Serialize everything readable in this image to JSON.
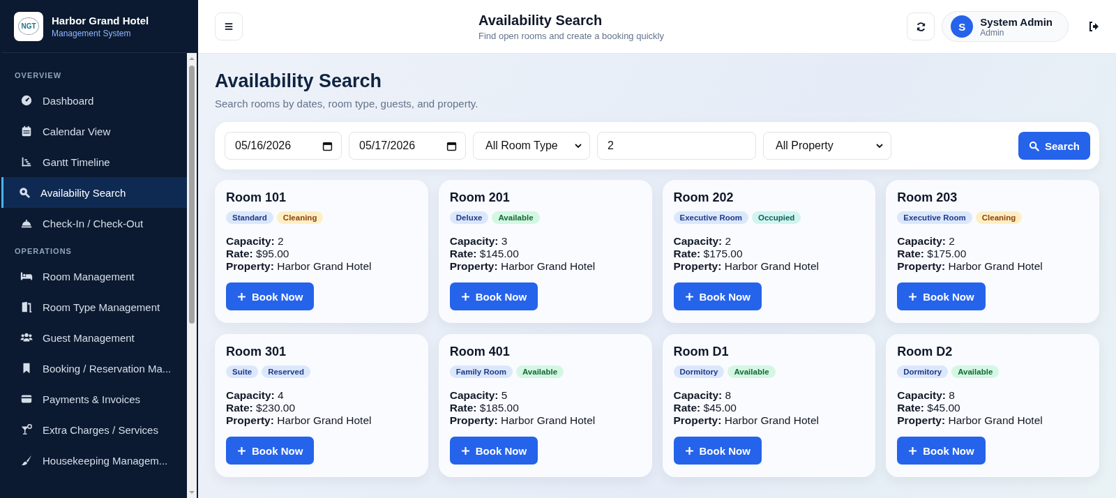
{
  "brand": {
    "logo": "NGT",
    "name": "Harbor Grand Hotel",
    "subtitle": "Management System"
  },
  "sidebar": {
    "sections": [
      {
        "title": "OVERVIEW",
        "items": [
          {
            "label": "Dashboard",
            "kind": "gauge",
            "selected": false
          },
          {
            "label": "Calendar View",
            "kind": "calendar",
            "selected": false
          },
          {
            "label": "Gantt Timeline",
            "kind": "gantt",
            "selected": false
          },
          {
            "label": "Availability Search",
            "kind": "search",
            "selected": true
          },
          {
            "label": "Check-In / Check-Out",
            "kind": "bell",
            "selected": false
          }
        ]
      },
      {
        "title": "OPERATIONS",
        "items": [
          {
            "label": "Room Management",
            "kind": "bed",
            "selected": false
          },
          {
            "label": "Room Type Management",
            "kind": "door",
            "selected": false
          },
          {
            "label": "Guest Management",
            "kind": "users",
            "selected": false
          },
          {
            "label": "Booking / Reservation Ma...",
            "kind": "bookmark",
            "selected": false
          },
          {
            "label": "Payments & Invoices",
            "kind": "card",
            "selected": false
          },
          {
            "label": "Extra Charges / Services",
            "kind": "glass",
            "selected": false
          },
          {
            "label": "Housekeeping Managem...",
            "kind": "brush",
            "selected": false
          }
        ]
      }
    ]
  },
  "header": {
    "title": "Availability Search",
    "subtitle": "Find open rooms and create a booking quickly",
    "user": {
      "initial": "S",
      "name": "System Admin",
      "role": "Admin"
    }
  },
  "page": {
    "title": "Availability Search",
    "subtitle": "Search rooms by dates, room type, guests, and property."
  },
  "filters": {
    "check_in": "05/16/2026",
    "check_out": "05/17/2026",
    "room_type": "All Room Type",
    "guests": "2",
    "property": "All Property",
    "search_button": "Search"
  },
  "rooms": [
    {
      "name": "Room 101",
      "type": "Standard",
      "status": {
        "label": "Cleaning",
        "kind": "cleaning"
      },
      "capacity_label": "Capacity:",
      "capacity": "2",
      "rate_label": "Rate:",
      "rate": "$95.00",
      "property_label": "Property:",
      "property": "Harbor Grand Hotel",
      "button": "Book Now"
    },
    {
      "name": "Room 201",
      "type": "Deluxe",
      "status": {
        "label": "Available",
        "kind": "available"
      },
      "capacity_label": "Capacity:",
      "capacity": "3",
      "rate_label": "Rate:",
      "rate": "$145.00",
      "property_label": "Property:",
      "property": "Harbor Grand Hotel",
      "button": "Book Now"
    },
    {
      "name": "Room 202",
      "type": "Executive Room",
      "status": {
        "label": "Occupied",
        "kind": "occupied"
      },
      "capacity_label": "Capacity:",
      "capacity": "2",
      "rate_label": "Rate:",
      "rate": "$175.00",
      "property_label": "Property:",
      "property": "Harbor Grand Hotel",
      "button": "Book Now"
    },
    {
      "name": "Room 203",
      "type": "Executive Room",
      "status": {
        "label": "Cleaning",
        "kind": "cleaning"
      },
      "capacity_label": "Capacity:",
      "capacity": "2",
      "rate_label": "Rate:",
      "rate": "$175.00",
      "property_label": "Property:",
      "property": "Harbor Grand Hotel",
      "button": "Book Now"
    },
    {
      "name": "Room 301",
      "type": "Suite",
      "status": {
        "label": "Reserved",
        "kind": "reserved"
      },
      "capacity_label": "Capacity:",
      "capacity": "4",
      "rate_label": "Rate:",
      "rate": "$230.00",
      "property_label": "Property:",
      "property": "Harbor Grand Hotel",
      "button": "Book Now"
    },
    {
      "name": "Room 401",
      "type": "Family Room",
      "status": {
        "label": "Available",
        "kind": "available"
      },
      "capacity_label": "Capacity:",
      "capacity": "5",
      "rate_label": "Rate:",
      "rate": "$185.00",
      "property_label": "Property:",
      "property": "Harbor Grand Hotel",
      "button": "Book Now"
    },
    {
      "name": "Room D1",
      "type": "Dormitory",
      "status": {
        "label": "Available",
        "kind": "available"
      },
      "capacity_label": "Capacity:",
      "capacity": "8",
      "rate_label": "Rate:",
      "rate": "$45.00",
      "property_label": "Property:",
      "property": "Harbor Grand Hotel",
      "button": "Book Now"
    },
    {
      "name": "Room D2",
      "type": "Dormitory",
      "status": {
        "label": "Available",
        "kind": "available"
      },
      "capacity_label": "Capacity:",
      "capacity": "8",
      "rate_label": "Rate:",
      "rate": "$45.00",
      "property_label": "Property:",
      "property": "Harbor Grand Hotel",
      "button": "Book Now"
    }
  ]
}
